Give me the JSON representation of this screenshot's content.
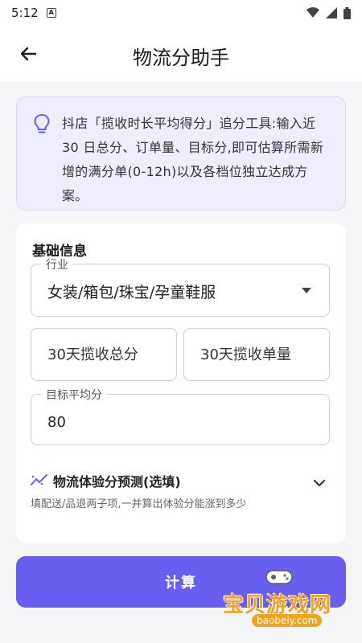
{
  "status_bar": {
    "time": "5:12",
    "notification_glyph": "A"
  },
  "app_bar": {
    "title": "物流分助手"
  },
  "tip": {
    "text": "抖店「揽收时长平均得分」追分工具:输入近30 日总分、订单量、目标分,即可估算所需新增的满分单(0-12h)以及各档位独立达成方案。"
  },
  "form": {
    "section_title": "基础信息",
    "industry": {
      "label": "行业",
      "value": "女装/箱包/珠宝/孕童鞋服"
    },
    "total_score": {
      "placeholder": "30天揽收总分"
    },
    "order_count": {
      "placeholder": "30天揽收单量"
    },
    "target_score": {
      "label": "目标平均分",
      "value": "80"
    },
    "forecast": {
      "title": "物流体验分预测(选填)",
      "subtitle": "填配送/品退两子项,一并算出体验分能涨到多少"
    }
  },
  "actions": {
    "calculate_label": "计算"
  },
  "watermark": {
    "text": "宝贝游戏网",
    "url": "baobeiy.com"
  },
  "colors": {
    "accent": "#6a5ef0",
    "tip_bg": "#eeedfb",
    "watermark": "#f2a21d"
  }
}
